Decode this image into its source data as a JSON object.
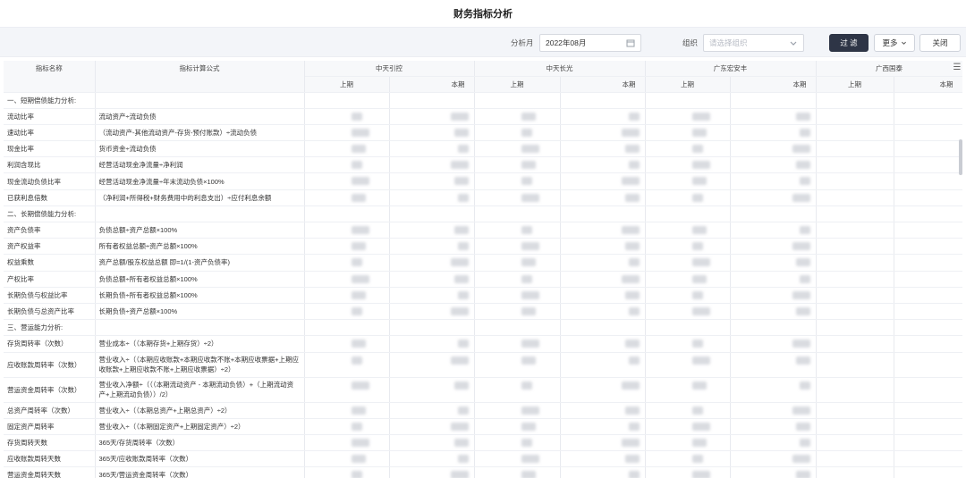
{
  "page_title": "财务指标分析",
  "filter": {
    "period_label": "分析月",
    "period_value": "2022年08月",
    "org_label": "组织",
    "org_placeholder": "请选择组织",
    "filter_button": "过 滤",
    "more_button": "更多",
    "close_button": "关闭"
  },
  "table": {
    "col_name": "指标名称",
    "col_formula": "指标计算公式",
    "companies": [
      "中天引控",
      "中天长光",
      "广东宏安丰",
      "广西国泰"
    ],
    "prev_label": "上期",
    "curr_label": "本期",
    "rows": [
      {
        "type": "section",
        "name": "一、短期偿债能力分析:",
        "formula": ""
      },
      {
        "type": "row",
        "name": "流动比率",
        "formula": "流动资产÷流动负债"
      },
      {
        "type": "row",
        "name": "速动比率",
        "formula": "（流动资产-其他流动资产-存货-预付账款）÷流动负债"
      },
      {
        "type": "row",
        "name": "现金比率",
        "formula": "货币资金÷流动负债"
      },
      {
        "type": "row",
        "name": "利润含现比",
        "formula": "经营活动现金净流量÷净利润"
      },
      {
        "type": "row",
        "name": "现金流动负债比率",
        "formula": "经营活动现金净流量÷年末流动负债×100%"
      },
      {
        "type": "row",
        "name": "已获利息倍数",
        "formula": "（净利润+所得税+财务费用中的利息支出）÷应付利息余额"
      },
      {
        "type": "section",
        "name": "二、长期偿债能力分析:",
        "formula": ""
      },
      {
        "type": "row",
        "name": "资产负债率",
        "formula": "负债总额÷资产总额×100%"
      },
      {
        "type": "row",
        "name": "资产权益率",
        "formula": "所有者权益总额÷资产总额×100%"
      },
      {
        "type": "row",
        "name": "权益乘数",
        "formula": "资产总额/股东权益总额 即=1/(1-资产负债率)"
      },
      {
        "type": "row",
        "name": "产权比率",
        "formula": "负债总额÷所有者权益总额×100%"
      },
      {
        "type": "row",
        "name": "长期负债与权益比率",
        "formula": "长期负债÷所有者权益总额×100%"
      },
      {
        "type": "row",
        "name": "长期负债与总资产比率",
        "formula": "长期负债÷资产总额×100%"
      },
      {
        "type": "section",
        "name": "三、营运能力分析:",
        "formula": ""
      },
      {
        "type": "row",
        "name": "存货周转率（次数）",
        "formula": "营业成本÷（（本期存货+上期存货）÷2）"
      },
      {
        "type": "tall",
        "name": "应收账款周转率（次数）",
        "formula": "营业收入÷（（本期应收账款+本期应收款不账+本期应收票据+上期应收账款+上期应收款不账+上期应收票据）÷2）"
      },
      {
        "type": "tall",
        "name": "营运资金周转率（次数）",
        "formula": "营业收入净额÷（（（本期流动资产 - 本期流动负债）+（上期流动资产+上期流动负债））/2）"
      },
      {
        "type": "row",
        "name": "总资产周转率（次数）",
        "formula": "营业收入÷（（本期总资产+上期总资产）÷2）"
      },
      {
        "type": "row",
        "name": "固定资产周转率",
        "formula": "营业收入÷（（本期固定资产+上期固定资产）÷2）"
      },
      {
        "type": "row",
        "name": "存货周转天数",
        "formula": "365天/存货周转率（次数）"
      },
      {
        "type": "row",
        "name": "应收账款周转天数",
        "formula": "365天/应收账款周转率（次数）"
      },
      {
        "type": "row",
        "name": "营运资金周转天数",
        "formula": "365天/营运资金周转率（次数）"
      }
    ]
  },
  "icons": {
    "calendar": "calendar-icon",
    "chevron": "chevron-down-icon",
    "menu": "column-menu-icon"
  }
}
